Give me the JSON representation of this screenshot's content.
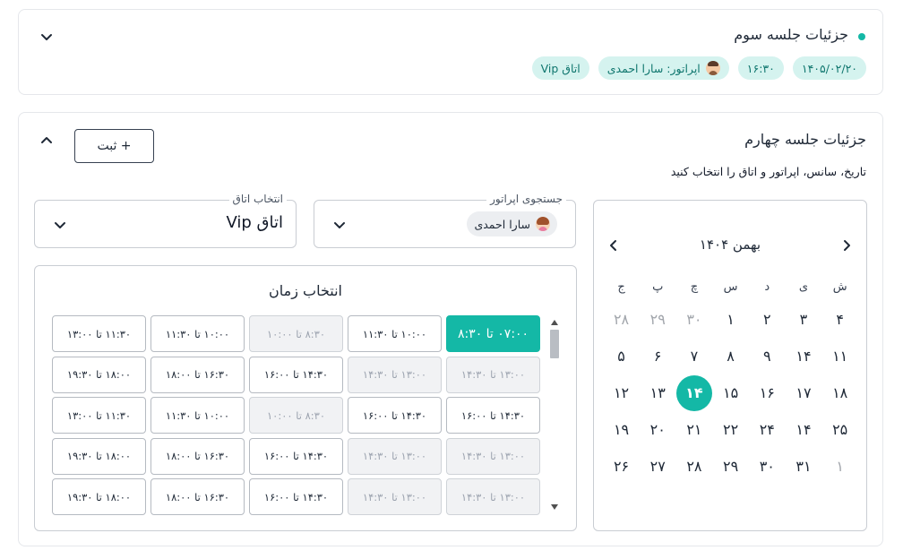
{
  "session3": {
    "title": "جزئیات جلسه سوم",
    "pills": {
      "date": "۱۴۰۵/۰۲/۲۰",
      "time": "۱۶:۳۰",
      "operator": "اپراتور: سارا احمدی",
      "room": "اتاق Vip"
    },
    "colors": {
      "accent": "#14b8a6",
      "pill_bg": "#d5f3ef"
    }
  },
  "session4": {
    "title": "جزئیات جلسه چهارم",
    "subtitle": "تاریخ، سانس، اپراتور و اتاق را انتخاب کنید",
    "submit_label": "+ ثبت",
    "room_field": {
      "label": "انتخاب اتاق",
      "value": "اتاق Vip"
    },
    "operator_field": {
      "label": "جستجوی اپراتور",
      "chip": "سارا احمدی"
    },
    "time_picker": {
      "title": "انتخاب زمان",
      "rows": [
        [
          {
            "label": "۰۷:۰۰ تا ۸:۳۰",
            "state": "selected"
          },
          {
            "label": "۱۰:۰۰ تا ۱۱:۳۰",
            "state": "enabled"
          },
          {
            "label": "۸:۳۰ تا ۱۰:۰۰",
            "state": "disabled"
          },
          {
            "label": "۱۰:۰۰ تا ۱۱:۳۰",
            "state": "enabled"
          },
          {
            "label": "۱۱:۳۰ تا ۱۳:۰۰",
            "state": "enabled"
          }
        ],
        [
          {
            "label": "۱۳:۰۰ تا ۱۴:۳۰",
            "state": "disabled"
          },
          {
            "label": "۱۳:۰۰ تا ۱۴:۳۰",
            "state": "disabled"
          },
          {
            "label": "۱۴:۳۰ تا ۱۶:۰۰",
            "state": "enabled"
          },
          {
            "label": "۱۶:۳۰ تا ۱۸:۰۰",
            "state": "enabled"
          },
          {
            "label": "۱۸:۰۰ تا ۱۹:۳۰",
            "state": "enabled"
          }
        ],
        [
          {
            "label": "۱۴:۳۰ تا ۱۶:۰۰",
            "state": "enabled"
          },
          {
            "label": "۱۴:۳۰ تا ۱۶:۰۰",
            "state": "enabled"
          },
          {
            "label": "۸:۳۰ تا ۱۰:۰۰",
            "state": "disabled"
          },
          {
            "label": "۱۰:۰۰ تا ۱۱:۳۰",
            "state": "enabled"
          },
          {
            "label": "۱۱:۳۰ تا ۱۳:۰۰",
            "state": "enabled"
          }
        ],
        [
          {
            "label": "۱۳:۰۰ تا ۱۴:۳۰",
            "state": "disabled"
          },
          {
            "label": "۱۳:۰۰ تا ۱۴:۳۰",
            "state": "disabled"
          },
          {
            "label": "۱۴:۳۰ تا ۱۶:۰۰",
            "state": "enabled"
          },
          {
            "label": "۱۶:۳۰ تا ۱۸:۰۰",
            "state": "enabled"
          },
          {
            "label": "۱۸:۰۰ تا ۱۹:۳۰",
            "state": "enabled"
          }
        ],
        [
          {
            "label": "۱۳:۰۰ تا ۱۴:۳۰",
            "state": "disabled"
          },
          {
            "label": "۱۳:۰۰ تا ۱۴:۳۰",
            "state": "disabled"
          },
          {
            "label": "۱۴:۳۰ تا ۱۶:۰۰",
            "state": "enabled"
          },
          {
            "label": "۱۶:۳۰ تا ۱۸:۰۰",
            "state": "enabled"
          },
          {
            "label": "۱۸:۰۰ تا ۱۹:۳۰",
            "state": "enabled"
          }
        ]
      ]
    },
    "calendar": {
      "month": "بهمن ۱۴۰۴",
      "weekdays": [
        "ش",
        "ی",
        "د",
        "س",
        "چ",
        "پ",
        "ج"
      ],
      "weeks": [
        [
          {
            "d": "۴"
          },
          {
            "d": "۳"
          },
          {
            "d": "۲"
          },
          {
            "d": "۱"
          },
          {
            "d": "۳۰",
            "m": true
          },
          {
            "d": "۲۹",
            "m": true
          },
          {
            "d": "۲۸",
            "m": true
          }
        ],
        [
          {
            "d": "۱۱"
          },
          {
            "d": "۱۴"
          },
          {
            "d": "۹"
          },
          {
            "d": "۸"
          },
          {
            "d": "۷"
          },
          {
            "d": "۶"
          },
          {
            "d": "۵"
          }
        ],
        [
          {
            "d": "۱۸"
          },
          {
            "d": "۱۷"
          },
          {
            "d": "۱۶"
          },
          {
            "d": "۱۵"
          },
          {
            "d": "۱۴",
            "s": true
          },
          {
            "d": "۱۳"
          },
          {
            "d": "۱۲"
          }
        ],
        [
          {
            "d": "۲۵"
          },
          {
            "d": "۱۴"
          },
          {
            "d": "۲۴"
          },
          {
            "d": "۲۲"
          },
          {
            "d": "۲۱"
          },
          {
            "d": "۲۰"
          },
          {
            "d": "۱۹"
          }
        ],
        [
          {
            "d": "۱",
            "m": true
          },
          {
            "d": "۳۱"
          },
          {
            "d": "۳۰"
          },
          {
            "d": "۲۹"
          },
          {
            "d": "۲۸"
          },
          {
            "d": "۲۷"
          },
          {
            "d": "۲۶"
          }
        ]
      ]
    }
  }
}
